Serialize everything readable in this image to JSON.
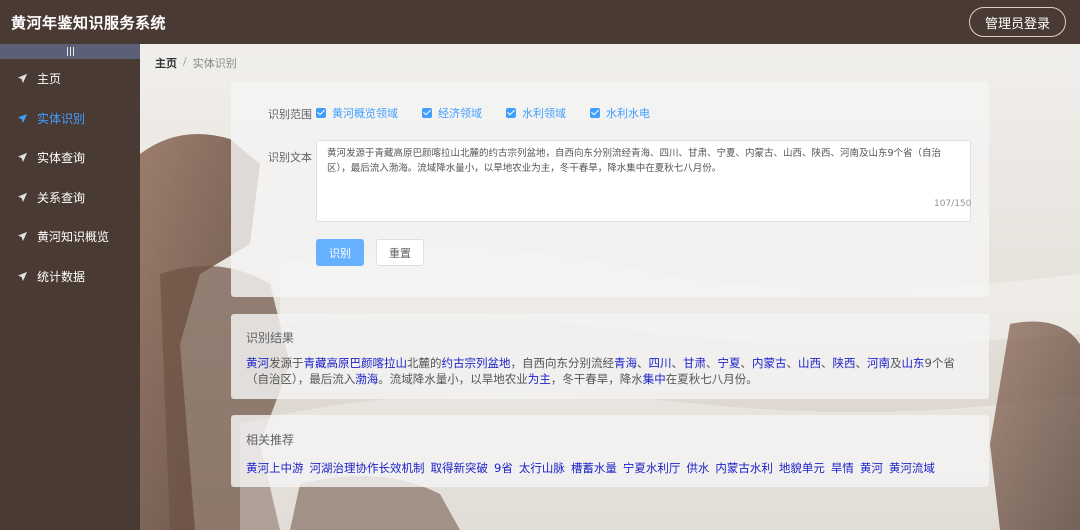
{
  "header": {
    "app_title": "黄河年鉴知识服务系统",
    "login_label": "管理员登录"
  },
  "sidebar": {
    "items": [
      {
        "label": "主页",
        "icon": "send-icon",
        "active": false
      },
      {
        "label": "实体识别",
        "icon": "send-icon",
        "active": true
      },
      {
        "label": "实体查询",
        "icon": "send-icon",
        "active": false
      },
      {
        "label": "关系查询",
        "icon": "send-icon",
        "active": false
      },
      {
        "label": "黄河知识概览",
        "icon": "send-icon",
        "active": false
      },
      {
        "label": "统计数据",
        "icon": "send-icon",
        "active": false
      }
    ]
  },
  "breadcrumb": {
    "home": "主页",
    "separator": "/",
    "current": "实体识别"
  },
  "form": {
    "scope_label": "识别范围",
    "scope_options": [
      {
        "label": "黄河概览领域",
        "checked": true
      },
      {
        "label": "经济领域",
        "checked": true
      },
      {
        "label": "水利领域",
        "checked": true
      },
      {
        "label": "水利水电",
        "checked": true
      }
    ],
    "text_label": "识别文本",
    "text_value": "黄河发源于青藏高原巴颜喀拉山北麓的约古宗列盆地，自西向东分别流经青海、四川、甘肃、宁夏、内蒙古、山西、陕西、河南及山东9个省（自治区），最后流入渤海。流域降水量小，以旱地农业为主，冬干春旱，降水集中在夏秋七八月份。",
    "word_count": "107/150",
    "recognize_label": "识别",
    "reset_label": "重置"
  },
  "result": {
    "title": "识别结果",
    "segments": [
      {
        "text": "黄河",
        "entity": true
      },
      {
        "text": "发源于",
        "entity": false
      },
      {
        "text": "青藏高原巴颜喀拉山",
        "entity": true
      },
      {
        "text": "北麓的",
        "entity": false
      },
      {
        "text": "约古宗列盆地",
        "entity": true
      },
      {
        "text": "，自西向东分别流经",
        "entity": false
      },
      {
        "text": "青海",
        "entity": true
      },
      {
        "text": "、",
        "entity": false
      },
      {
        "text": "四川",
        "entity": true
      },
      {
        "text": "、",
        "entity": false
      },
      {
        "text": "甘肃",
        "entity": true
      },
      {
        "text": "、",
        "entity": false
      },
      {
        "text": "宁夏",
        "entity": true
      },
      {
        "text": "、",
        "entity": false
      },
      {
        "text": "内蒙古",
        "entity": true
      },
      {
        "text": "、",
        "entity": false
      },
      {
        "text": "山西",
        "entity": true
      },
      {
        "text": "、",
        "entity": false
      },
      {
        "text": "陕西",
        "entity": true
      },
      {
        "text": "、",
        "entity": false
      },
      {
        "text": "河南",
        "entity": true
      },
      {
        "text": "及",
        "entity": false
      },
      {
        "text": "山东",
        "entity": true
      },
      {
        "text": "9个省（自治区），最后流入",
        "entity": false
      },
      {
        "text": "渤海",
        "entity": true
      },
      {
        "text": "。流域降水量小，以旱地农业",
        "entity": false
      },
      {
        "text": "为主",
        "entity": true
      },
      {
        "text": "，冬干春旱，降水",
        "entity": false
      },
      {
        "text": "集中",
        "entity": true
      },
      {
        "text": "在夏秋七八月份。",
        "entity": false
      }
    ]
  },
  "recommend": {
    "title": "相关推荐",
    "items": [
      "黄河上中游",
      "河湖治理协作长效机制",
      "取得新突破",
      "9省",
      "太行山脉",
      "槽蓄水量",
      "宁夏水利厅",
      "供水",
      "内蒙古水利",
      "地貌单元",
      "旱情",
      "黄河",
      "黄河流域"
    ]
  },
  "colors": {
    "sidebar_bg": "#4a3a34",
    "accent": "#409eff",
    "entity": "#1d23c8",
    "collapse_bar": "#5b6076"
  }
}
